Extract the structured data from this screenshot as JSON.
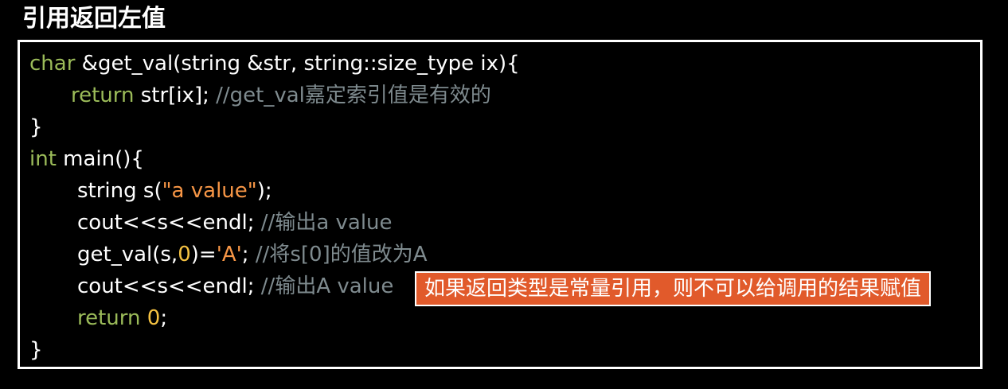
{
  "title": "引用返回左值",
  "code": {
    "l1_kw": "char",
    "l1_rest": " &get_val(string &str, string::size_type ix){",
    "l2_kw": "return",
    "l2_rest": " str[ix]; ",
    "l2_cmt": "//get_val嘉定索引值是有效的",
    "l3": "}",
    "l4_kw": "int",
    "l4_rest": " main(){",
    "l5_a": "string s(",
    "l5_str": "\"a value\"",
    "l5_b": ");",
    "l6_a": "cout<<s<<endl; ",
    "l6_cmt": "//输出a value",
    "l7_a": "get_val(s,",
    "l7_num": "0",
    "l7_b": ")=",
    "l7_str": "'A'",
    "l7_c": "; ",
    "l7_cmt": "//将s[0]的值改为A",
    "l8_a": "cout<<s<<endl; ",
    "l8_cmt": "//输出A value",
    "l9_kw": "return",
    "l9_num": "0",
    "l9_b": ";",
    "l10": "}"
  },
  "callout": "如果返回类型是常量引用，则不可以给调用的结果赋值",
  "colors": {
    "keyword": "#9bbb59",
    "number": "#f5c242",
    "string": "#f79646",
    "comment": "#7f8b8f",
    "callout_bg": "#e15a2b"
  }
}
